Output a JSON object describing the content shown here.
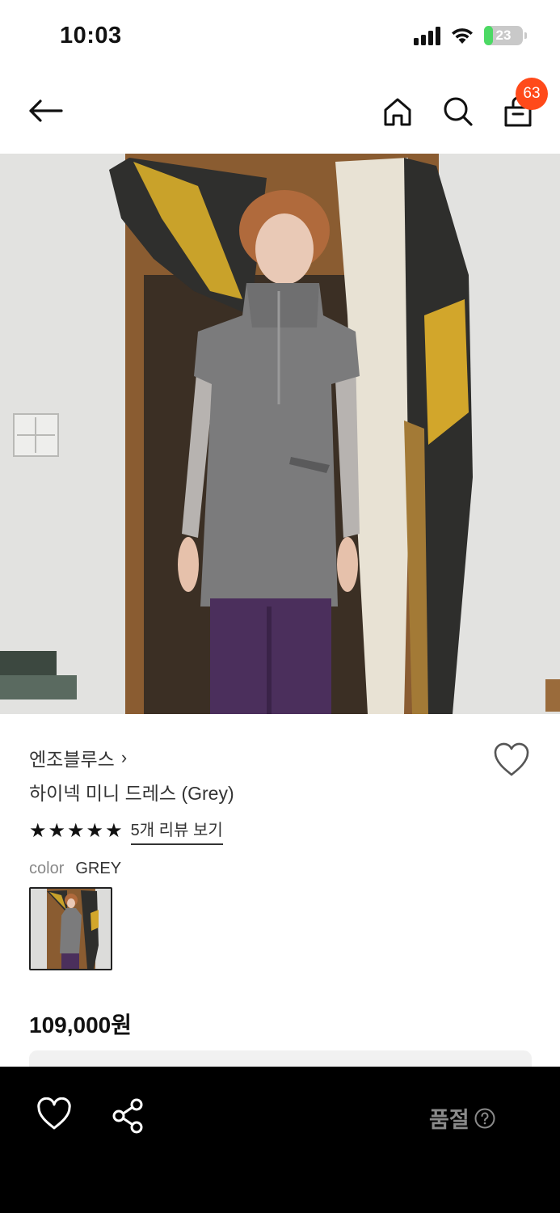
{
  "status_bar": {
    "time": "10:03",
    "battery": "23",
    "battery_level": 0.23
  },
  "header": {
    "cart_count": "63",
    "icons": [
      "back-arrow-icon",
      "home-icon",
      "search-icon",
      "shopping-bag-icon"
    ]
  },
  "product": {
    "brand": "엔조블루스",
    "brand_chevron": "›",
    "name": "하이넥 미니 드레스 (Grey)",
    "rating": 5,
    "stars": [
      "★",
      "★",
      "★",
      "★",
      "★"
    ],
    "review_link": "5개 리뷰 보기",
    "color_label": "color",
    "color_value": "GREY",
    "price": "109,000원"
  },
  "bottom_bar": {
    "status": "품절",
    "icons": [
      "heart-icon",
      "share-icon",
      "help-circle-icon"
    ]
  },
  "colors": {
    "badge": "#ff4a1a",
    "bottom_bar": "#000000",
    "soldout_text": "#8a8a8a",
    "battery_fill": "#4cd964"
  }
}
